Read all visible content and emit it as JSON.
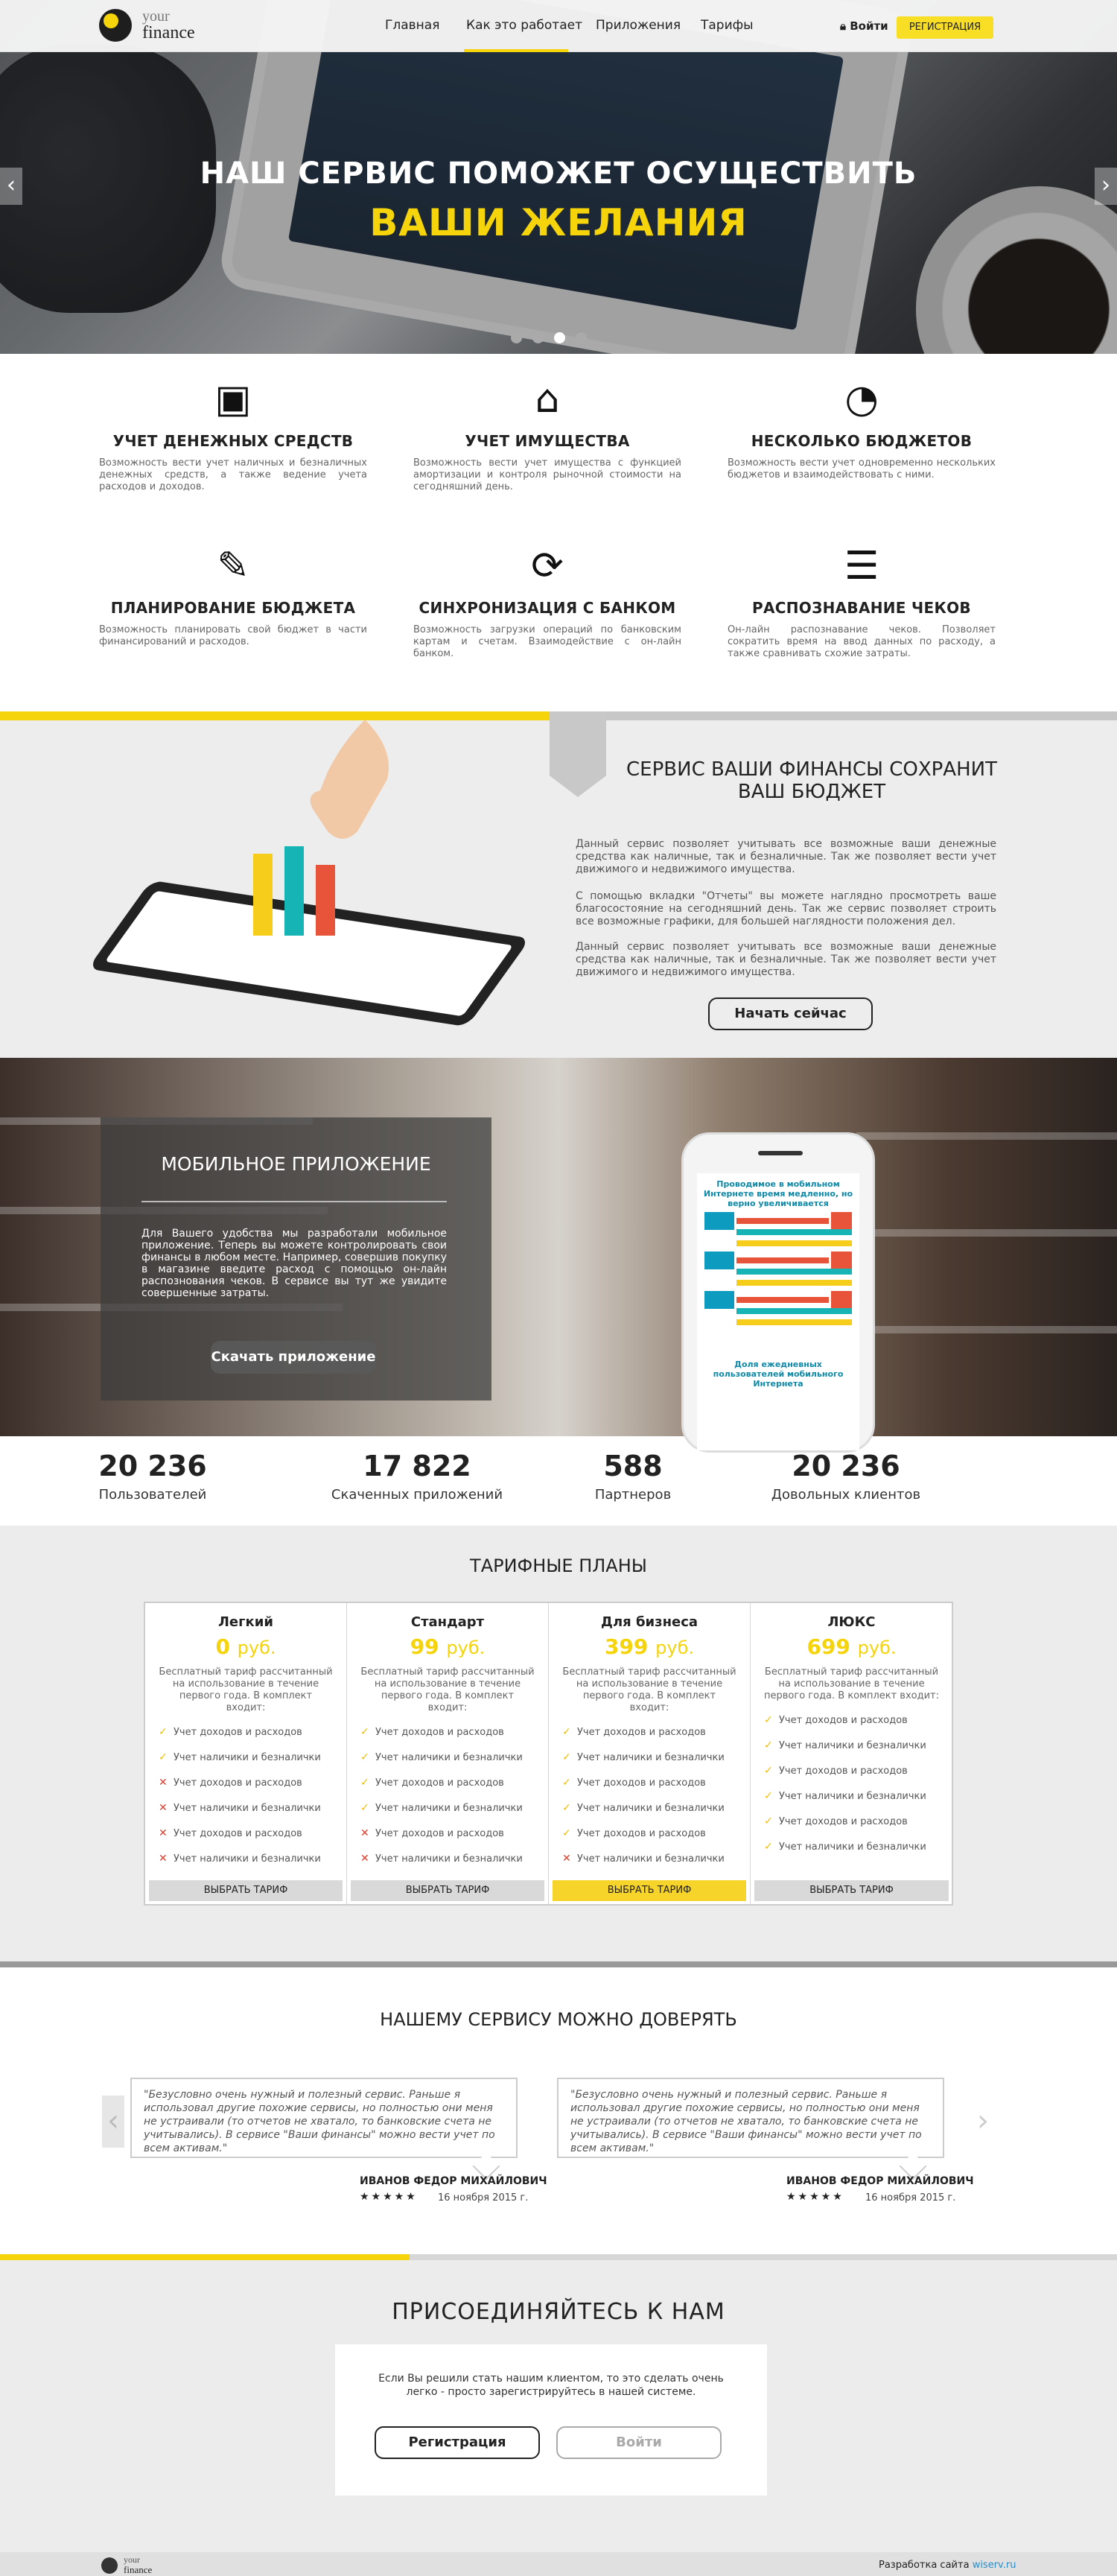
{
  "header": {
    "logo_line1": "your",
    "logo_line2": "finance",
    "nav": [
      "Главная",
      "Как это работает",
      "Приложения",
      "Тарифы"
    ],
    "login": "Войти",
    "register": "РЕГИСТРАЦИЯ"
  },
  "hero": {
    "line1": "НАШ СЕРВИС ПОМОЖЕТ ОСУЩЕСТВИТЬ",
    "line2": "ВАШИ ЖЕЛАНИЯ",
    "prev": "‹",
    "next": "›"
  },
  "features": [
    {
      "icon": "wallet-icon",
      "glyph": "👛",
      "title": "УЧЕТ ДЕНЕЖНЫХ СРЕДСТВ",
      "text": "Возможность вести учет наличных и безналичных денежных средств, а также ведение учета расходов и доходов."
    },
    {
      "icon": "home-icon",
      "glyph": "⌂",
      "title": "УЧЕТ ИМУЩЕСТВА",
      "text": "Возможность вести учет имущества с функцией амортизации и контроля рыночной стоимости на сегодняшний день."
    },
    {
      "icon": "pie-chart-icon",
      "glyph": "◔",
      "title": "НЕСКОЛЬКО БЮДЖЕТОВ",
      "text": "Возможность вести учет одновременно нескольких бюджетов и взаимодействовать с ними."
    },
    {
      "icon": "budget-document-icon",
      "glyph": "📋",
      "title": "ПЛАНИРОВАНИЕ БЮДЖЕТА",
      "text": "Возможность планировать свой бюджет в части финансирований и расходов."
    },
    {
      "icon": "sync-icon",
      "glyph": "⟳",
      "title": "СИНХРОНИЗАЦИЯ С БАНКОМ",
      "text": "Возможность загрузки операций по банковским картам и счетам. Взаимодействие с он-лайн банком."
    },
    {
      "icon": "receipt-icon",
      "glyph": "🧾",
      "title": "РАСПОЗНАВАНИЕ ЧЕКОВ",
      "text": "Он-лайн распознавание чеков. Позволяет сократить время на ввод данных по расходу, а также сравнивать схожие затраты."
    }
  ],
  "service": {
    "title": "СЕРВИС ВАШИ ФИНАНСЫ СОХРАНИТ ВАШ БЮДЖЕТ",
    "paragraphs": [
      "Данный сервис позволяет учитывать все возможные ваши денежные средства как наличные, так и безналичные. Так же позволяет вести учет движимого и недвижимого имущества.",
      "С помощью вкладки \"Отчеты\" вы можете наглядно просмотреть ваше благосостояние на сегодняшний день. Так же сервис позволяет строить все возможные графики, для большей наглядности положения дел.",
      "Данный сервис позволяет учитывать все возможные ваши денежные средства как наличные, так и безналичные. Так же позволяет вести учет движимого и недвижимого имущества."
    ],
    "button": "Начать сейчас"
  },
  "mobile": {
    "title": "МОБИЛЬНОЕ ПРИЛОЖЕНИЕ",
    "text": "Для Вашего удобства мы разработали мобильное приложение. Теперь вы можете контролировать свои финансы в любом месте. Например, совершив покупку в магазине введите расход с помощью он-лайн распознования чеков. В сервисе вы тут же увидите совершенные затраты.",
    "button": "Скачать приложение",
    "phone_title": "Проводимое в мобильном Интернете время медленно, но верно увеличивается",
    "phone_bottom": "Доля ежедневных пользователей мобильного Интернета"
  },
  "stats": [
    {
      "value": "20 236",
      "label": "Пользователей"
    },
    {
      "value": "17 822",
      "label": "Скаченных приложений"
    },
    {
      "value": "588",
      "label": "Партнеров"
    },
    {
      "value": "20 236",
      "label": "Довольных клиентов"
    }
  ],
  "tariffs": {
    "title": "ТАРИФНЫЕ ПЛАНЫ",
    "currency": "руб.",
    "desc": "Бесплатный тариф рассчитанный на использование в течение первого года. В комплект входит:",
    "button": "ВЫБРАТЬ ТАРИФ",
    "plans": [
      {
        "name": "Легкий",
        "price": "0",
        "features": [
          {
            "text": "Учет доходов и расходов",
            "ok": true
          },
          {
            "text": "Учет наличики и безналички",
            "ok": true
          },
          {
            "text": "Учет доходов и расходов",
            "ok": false
          },
          {
            "text": "Учет наличики и безналички",
            "ok": false
          },
          {
            "text": "Учет доходов и расходов",
            "ok": false
          },
          {
            "text": "Учет наличики и безналички",
            "ok": false
          }
        ]
      },
      {
        "name": "Стандарт",
        "price": "99",
        "features": [
          {
            "text": "Учет доходов и расходов",
            "ok": true
          },
          {
            "text": "Учет наличики и безналички",
            "ok": true
          },
          {
            "text": "Учет доходов и расходов",
            "ok": true
          },
          {
            "text": "Учет наличики и безналички",
            "ok": true
          },
          {
            "text": "Учет доходов и расходов",
            "ok": false
          },
          {
            "text": "Учет наличики и безналички",
            "ok": false
          }
        ]
      },
      {
        "name": "Для бизнеса",
        "price": "399",
        "features": [
          {
            "text": "Учет доходов и расходов",
            "ok": true
          },
          {
            "text": "Учет наличики и безналички",
            "ok": true
          },
          {
            "text": "Учет доходов и расходов",
            "ok": true
          },
          {
            "text": "Учет наличики и безналички",
            "ok": true
          },
          {
            "text": "Учет доходов и расходов",
            "ok": true
          },
          {
            "text": "Учет наличики и безналички",
            "ok": false
          }
        ]
      },
      {
        "name": "ЛЮКС",
        "price": "699",
        "features": [
          {
            "text": "Учет доходов и расходов",
            "ok": true
          },
          {
            "text": "Учет наличики и безналички",
            "ok": true
          },
          {
            "text": "Учет доходов и расходов",
            "ok": true
          },
          {
            "text": "Учет наличики и безналички",
            "ok": true
          },
          {
            "text": "Учет доходов и расходов",
            "ok": true
          },
          {
            "text": "Учет наличики и безналички",
            "ok": true
          }
        ]
      }
    ]
  },
  "trust": {
    "title": "НАШЕМУ СЕРВИСУ МОЖНО ДОВЕРЯТЬ",
    "reviews": [
      {
        "text": "\"Безусловно очень нужный и полезный сервис. Раньше я использовал другие похожие сервисы, но полностью они меня не устраивали (то отчетов не хватало, то банковские счета не учитывались). В сервисе \"Ваши финансы\" можно вести учет по всем активам.\"",
        "name": "ИВАНОВ ФЕДОР МИХАЙЛОВИЧ",
        "stars": "★★★★★",
        "date": "16 ноября 2015 г."
      },
      {
        "text": "\"Безусловно очень нужный и полезный сервис. Раньше я использовал другие похожие сервисы, но полностью они меня не устраивали (то отчетов не хватало, то банковские счета не учитывались). В сервисе \"Ваши финансы\" можно вести учет по всем активам.\"",
        "name": "ИВАНОВ ФЕДОР МИХАЙЛОВИЧ",
        "stars": "★★★★★",
        "date": "16 ноября 2015 г."
      }
    ]
  },
  "join": {
    "title": "ПРИСОЕДИНЯЙТЕСЬ К НАМ",
    "text": "Если Вы решили стать нашим клиентом, то это сделать очень легко - просто зарегистрируйтесь в нашей системе.",
    "register": "Регистрация",
    "login": "Войти"
  },
  "footer": {
    "logo_line1": "your",
    "logo_line2": "finance",
    "credit_prefix": "Разработка сайта",
    "credit_link": "wiserv.ru"
  },
  "colors": {
    "accent": "#f6d40b",
    "dark": "#222222",
    "gray_bg": "#ececec"
  }
}
